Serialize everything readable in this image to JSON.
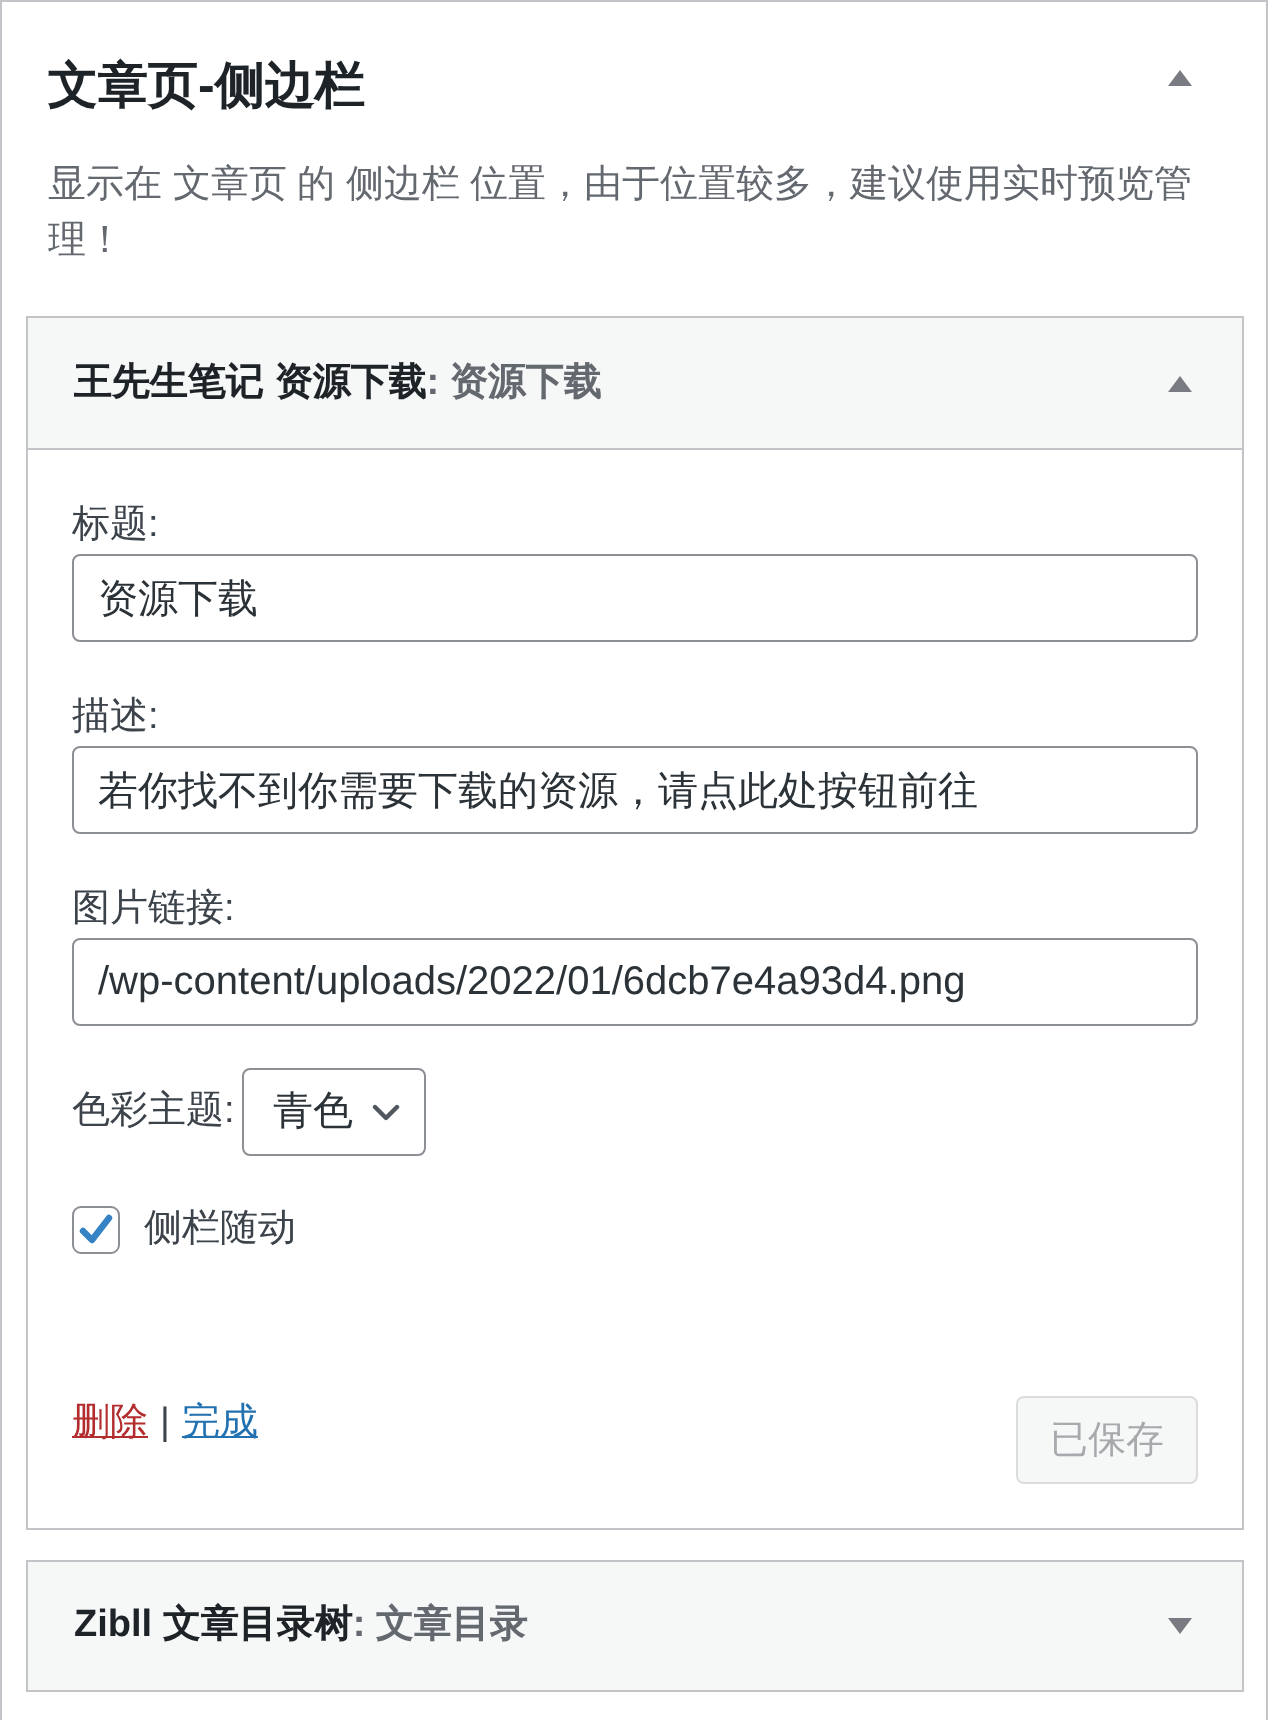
{
  "panel": {
    "title": "文章页-侧边栏",
    "expanded": true,
    "description": "显示在 文章页 的 侧边栏 位置，由于位置较多，建议使用实时预览管理！"
  },
  "widgets": [
    {
      "name": "王先生笔记 资源下载",
      "title": ": 资源下载",
      "expanded": true,
      "fields": [
        {
          "kind": "text",
          "label": "标题:",
          "value": "资源下载"
        },
        {
          "kind": "text",
          "label": "描述:",
          "value": "若你找不到你需要下载的资源，请点此处按钮前往"
        },
        {
          "kind": "text",
          "label": "图片链接:",
          "value": "/wp-content/uploads/2022/01/6dcb7e4a93d4.png"
        },
        {
          "kind": "select",
          "label": "色彩主题:",
          "value": "青色"
        },
        {
          "kind": "checkbox",
          "label": "侧栏随动",
          "checked": true
        }
      ],
      "actions": [
        {
          "kind": "delete",
          "label": "删除"
        },
        {
          "kind": "done",
          "label": "完成"
        }
      ],
      "separator": "|",
      "save_button": {
        "label": "已保存",
        "disabled": true
      }
    },
    {
      "name": "Zibll 文章目录树",
      "title": ": 文章目录",
      "expanded": false
    }
  ]
}
